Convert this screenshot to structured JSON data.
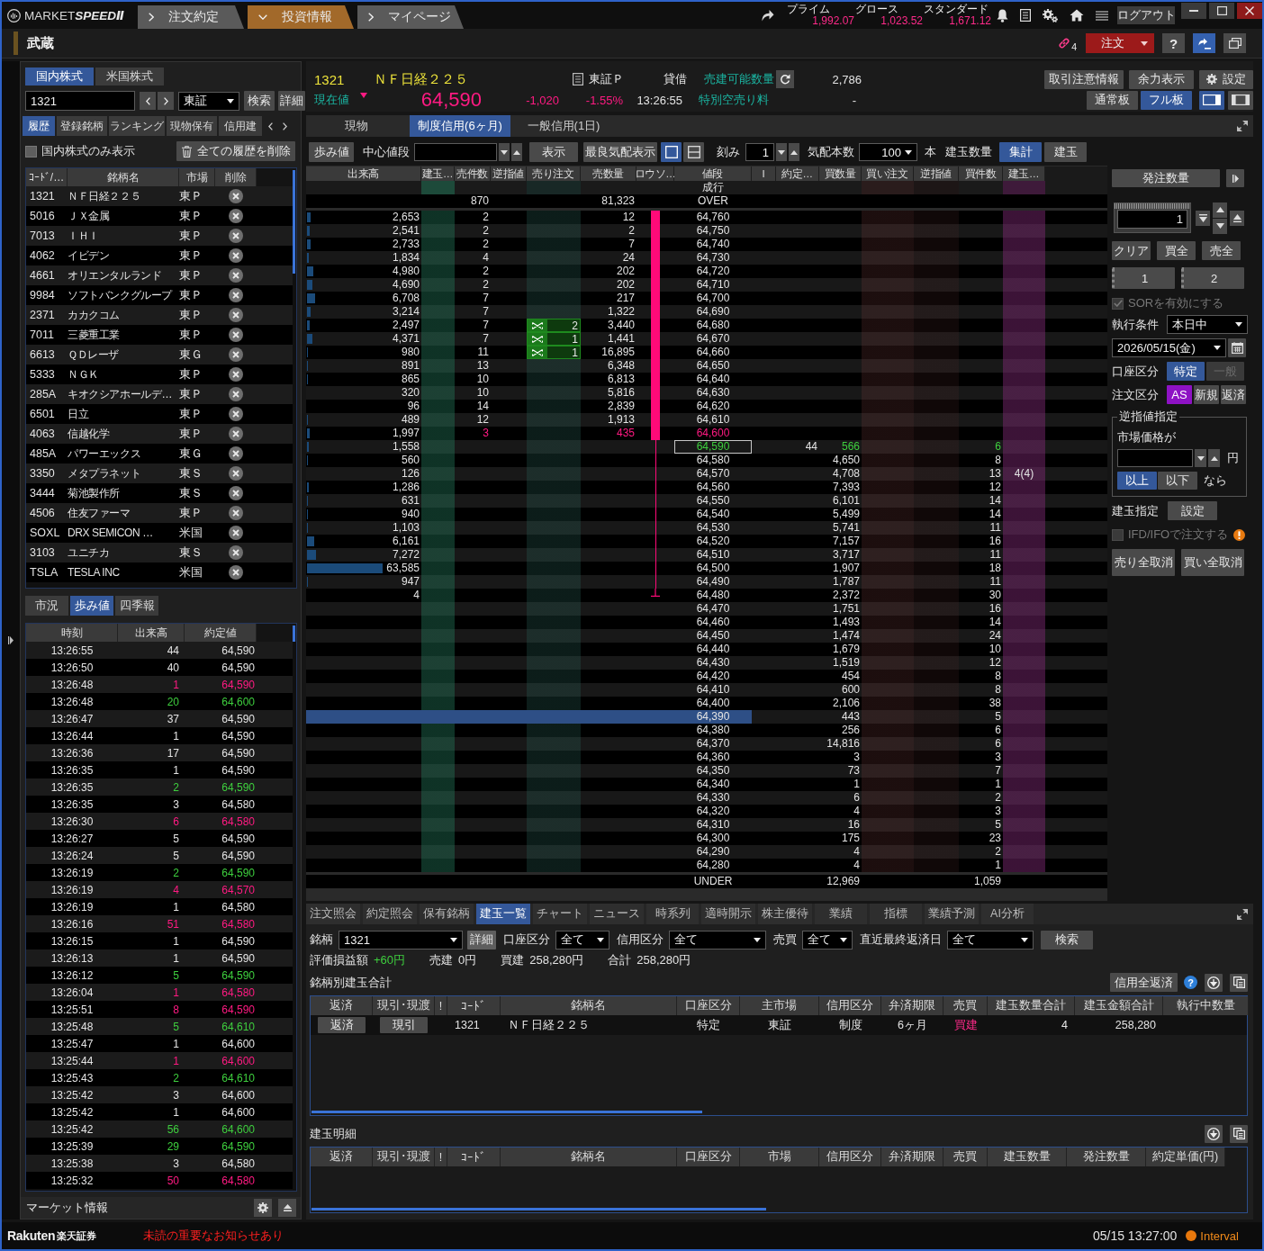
{
  "title_bar": {
    "logo": "MARKET**SPEEDⅡ**",
    "nav_tabs": [
      {
        "label": "注文約定",
        "selected": false
      },
      {
        "label": "投資情報",
        "selected": true
      },
      {
        "label": "マイページ",
        "selected": false
      }
    ],
    "indices": [
      {
        "name": "プライム",
        "value": "1,992.07"
      },
      {
        "name": "グロース",
        "value": "1,023.52"
      },
      {
        "name": "スタンダード",
        "value": "1,671.12"
      }
    ],
    "logout": "ログアウト"
  },
  "window": {
    "title": "武蔵",
    "link_count": "4",
    "order_button": "注文",
    "help_button": "?"
  },
  "left_panel": {
    "market_tabs": [
      {
        "label": "国内株式",
        "selected": true
      },
      {
        "label": "米国株式",
        "selected": false
      }
    ],
    "code_input": {
      "value": "1321"
    },
    "exchange": "東証",
    "search_button": "検索",
    "detail_button": "詳細",
    "list_tabs": [
      {
        "label": "履歴",
        "selected": true
      },
      {
        "label": "登録銘柄",
        "selected": false
      },
      {
        "label": "ランキング",
        "selected": false
      },
      {
        "label": "現物保有",
        "selected": false
      },
      {
        "label": "信用建",
        "selected": false
      }
    ],
    "domestic_only": {
      "label": "国内株式のみ表示",
      "checked": false
    },
    "clear_history_button": "全ての履歴を削除",
    "history": {
      "columns": [
        "ｺｰﾄﾞ/…",
        "銘柄名",
        "市場",
        "削除"
      ],
      "rows": [
        {
          "code": "1321",
          "name": "ＮＦ日経２２５",
          "market": "東Ｐ"
        },
        {
          "code": "5016",
          "name": "ＪＸ金属",
          "market": "東Ｐ"
        },
        {
          "code": "7013",
          "name": "ＩＨＩ",
          "market": "東Ｐ"
        },
        {
          "code": "4062",
          "name": "イビデン",
          "market": "東Ｐ"
        },
        {
          "code": "4661",
          "name": "オリエンタルランド",
          "market": "東Ｐ"
        },
        {
          "code": "9984",
          "name": "ソフトバンクグループ",
          "market": "東Ｐ"
        },
        {
          "code": "2371",
          "name": "カカクコム",
          "market": "東Ｐ"
        },
        {
          "code": "7011",
          "name": "三菱重工業",
          "market": "東Ｐ"
        },
        {
          "code": "6613",
          "name": "ＱＤレーザ",
          "market": "東Ｇ"
        },
        {
          "code": "5333",
          "name": "ＮＧＫ",
          "market": "東Ｐ"
        },
        {
          "code": "285A",
          "name": "キオクシアホールデ…",
          "market": "東Ｐ"
        },
        {
          "code": "6501",
          "name": "日立",
          "market": "東Ｐ"
        },
        {
          "code": "4063",
          "name": "信越化学",
          "market": "東Ｐ"
        },
        {
          "code": "485A",
          "name": "パワーエックス",
          "market": "東Ｇ"
        },
        {
          "code": "3350",
          "name": "メタプラネット",
          "market": "東Ｓ"
        },
        {
          "code": "3444",
          "name": "菊池製作所",
          "market": "東Ｓ"
        },
        {
          "code": "4506",
          "name": "住友ファーマ",
          "market": "東Ｐ"
        },
        {
          "code": "SOXL",
          "name": "DRX SEMICON …",
          "market": "米国"
        },
        {
          "code": "3103",
          "name": "ユニチカ",
          "market": "東Ｓ"
        },
        {
          "code": "TSLA",
          "name": "TESLA INC",
          "market": "米国"
        }
      ]
    },
    "info_tabs": [
      {
        "label": "市況",
        "selected": false
      },
      {
        "label": "歩み値",
        "selected": true
      },
      {
        "label": "四季報",
        "selected": false
      }
    ],
    "trades": {
      "columns": [
        "時刻",
        "出来高",
        "約定値"
      ],
      "rows": [
        {
          "time": "13:26:55",
          "volume": "44",
          "price": "64,590",
          "kind": "flat"
        },
        {
          "time": "13:26:50",
          "volume": "40",
          "price": "64,590",
          "kind": "flat"
        },
        {
          "time": "13:26:48",
          "volume": "1",
          "price": "64,590",
          "kind": "down"
        },
        {
          "time": "13:26:48",
          "volume": "20",
          "price": "64,600",
          "kind": "up"
        },
        {
          "time": "13:26:47",
          "volume": "37",
          "price": "64,590",
          "kind": "flat"
        },
        {
          "time": "13:26:44",
          "volume": "1",
          "price": "64,590",
          "kind": "flat"
        },
        {
          "time": "13:26:36",
          "volume": "17",
          "price": "64,590",
          "kind": "flat"
        },
        {
          "time": "13:26:35",
          "volume": "1",
          "price": "64,590",
          "kind": "flat"
        },
        {
          "time": "13:26:35",
          "volume": "2",
          "price": "64,590",
          "kind": "up"
        },
        {
          "time": "13:26:35",
          "volume": "3",
          "price": "64,580",
          "kind": "flat"
        },
        {
          "time": "13:26:30",
          "volume": "6",
          "price": "64,580",
          "kind": "down"
        },
        {
          "time": "13:26:27",
          "volume": "5",
          "price": "64,590",
          "kind": "flat"
        },
        {
          "time": "13:26:24",
          "volume": "5",
          "price": "64,590",
          "kind": "flat"
        },
        {
          "time": "13:26:19",
          "volume": "2",
          "price": "64,590",
          "kind": "up"
        },
        {
          "time": "13:26:19",
          "volume": "4",
          "price": "64,570",
          "kind": "down"
        },
        {
          "time": "13:26:19",
          "volume": "1",
          "price": "64,580",
          "kind": "flat"
        },
        {
          "time": "13:26:16",
          "volume": "51",
          "price": "64,580",
          "kind": "down"
        },
        {
          "time": "13:26:15",
          "volume": "1",
          "price": "64,590",
          "kind": "flat"
        },
        {
          "time": "13:26:13",
          "volume": "1",
          "price": "64,590",
          "kind": "flat"
        },
        {
          "time": "13:26:12",
          "volume": "5",
          "price": "64,590",
          "kind": "up"
        },
        {
          "time": "13:26:04",
          "volume": "1",
          "price": "64,580",
          "kind": "down"
        },
        {
          "time": "13:25:51",
          "volume": "8",
          "price": "64,590",
          "kind": "down"
        },
        {
          "time": "13:25:48",
          "volume": "5",
          "price": "64,610",
          "kind": "up"
        },
        {
          "time": "13:25:47",
          "volume": "1",
          "price": "64,600",
          "kind": "flat"
        },
        {
          "time": "13:25:44",
          "volume": "1",
          "price": "64,600",
          "kind": "down"
        },
        {
          "time": "13:25:43",
          "volume": "2",
          "price": "64,610",
          "kind": "up"
        },
        {
          "time": "13:25:42",
          "volume": "3",
          "price": "64,600",
          "kind": "flat"
        },
        {
          "time": "13:25:42",
          "volume": "1",
          "price": "64,600",
          "kind": "flat"
        },
        {
          "time": "13:25:42",
          "volume": "56",
          "price": "64,600",
          "kind": "up"
        },
        {
          "time": "13:25:39",
          "volume": "29",
          "price": "64,590",
          "kind": "up"
        },
        {
          "time": "13:25:38",
          "volume": "3",
          "price": "64,580",
          "kind": "flat"
        },
        {
          "time": "13:25:32",
          "volume": "50",
          "price": "64,580",
          "kind": "down"
        }
      ]
    },
    "footer": "マーケット情報"
  },
  "quote": {
    "code": "1321",
    "name": "ＮＦ日経２２５",
    "exchange": "東証Ｐ",
    "margin_type": "貸借",
    "sellable_label": "売建可能数量",
    "sellable": "2,786",
    "price_label": "現在値",
    "price_down": true,
    "price": "64,590",
    "change": "-1,020",
    "change_pct": "-1.55%",
    "time": "13:26:55",
    "fee_label": "特別空売り料",
    "fee": "-",
    "buttons": [
      "取引注意情報",
      "余力表示",
      "設定"
    ],
    "board_modes": [
      {
        "label": "通常板",
        "selected": false
      },
      {
        "label": "フル板",
        "selected": true
      }
    ],
    "layouts": [
      {
        "kind": "single",
        "selected": true
      },
      {
        "kind": "triple",
        "selected": false
      }
    ]
  },
  "board_tabs": [
    {
      "label": "現物",
      "selected": false
    },
    {
      "label": "制度信用(6ヶ月)",
      "selected": true
    },
    {
      "label": "一般信用(1日)",
      "selected": false
    }
  ],
  "toolbar": {
    "trades_button": "歩み値",
    "center_label": "中心値段",
    "show_button": "表示",
    "best_button": "最良気配表示",
    "views": [
      {
        "kind": "single",
        "selected": true
      },
      {
        "kind": "split",
        "selected": false
      }
    ],
    "tick_label": "刻み",
    "tick_value": "1",
    "depth_label": "気配本数",
    "depth_value": "100",
    "depth_unit": "本",
    "position_label": "建玉数量",
    "position_modes": [
      {
        "label": "集計",
        "selected": true
      },
      {
        "label": "建玉",
        "selected": false
      }
    ]
  },
  "board": {
    "columns": [
      "出来高",
      "建玉…",
      "売件数",
      "逆指値",
      "売り注文",
      "売数量",
      "ロウソ…",
      "値段",
      "I",
      "約定…",
      "買数量",
      "買い注文",
      "逆指値",
      "買件数",
      "建玉…"
    ],
    "market_row": {
      "price": "成行"
    },
    "over_row": {
      "sell_count": "870",
      "sell_qty": "81,323",
      "price": "OVER"
    },
    "rows": [
      {
        "volume": "2,653",
        "sell_count": "2",
        "sell_qty": "12",
        "price": "64,760",
        "kind": "plain",
        "current": false,
        "candle_body": true,
        "candle_wick": false,
        "selected": false
      },
      {
        "volume": "2,541",
        "sell_count": "2",
        "sell_qty": "2",
        "price": "64,750",
        "kind": "plain",
        "current": false,
        "candle_body": true,
        "candle_wick": false,
        "selected": false
      },
      {
        "volume": "2,733",
        "sell_count": "2",
        "sell_qty": "7",
        "price": "64,740",
        "kind": "plain",
        "current": false,
        "candle_body": true,
        "candle_wick": false,
        "selected": false
      },
      {
        "volume": "1,834",
        "sell_count": "4",
        "sell_qty": "24",
        "price": "64,730",
        "kind": "plain",
        "current": false,
        "candle_body": true,
        "candle_wick": false,
        "selected": false
      },
      {
        "volume": "4,980",
        "sell_count": "2",
        "sell_qty": "202",
        "price": "64,720",
        "kind": "plain",
        "current": false,
        "candle_body": true,
        "candle_wick": false,
        "selected": false
      },
      {
        "volume": "4,690",
        "sell_count": "2",
        "sell_qty": "202",
        "price": "64,710",
        "kind": "plain",
        "current": false,
        "candle_body": true,
        "candle_wick": false,
        "selected": false
      },
      {
        "volume": "6,708",
        "sell_count": "7",
        "sell_qty": "217",
        "price": "64,700",
        "kind": "plain",
        "current": false,
        "candle_body": true,
        "candle_wick": false,
        "selected": false
      },
      {
        "volume": "3,214",
        "sell_count": "7",
        "sell_qty": "1,322",
        "price": "64,690",
        "kind": "plain",
        "current": false,
        "candle_body": true,
        "candle_wick": false,
        "selected": false
      },
      {
        "volume": "2,497",
        "sell_count": "7",
        "sell_order": "2",
        "sell_qty": "3,440",
        "price": "64,680",
        "kind": "plain",
        "current": false,
        "candle_body": true,
        "candle_wick": false,
        "selected": false
      },
      {
        "volume": "4,371",
        "sell_count": "7",
        "sell_order": "1",
        "sell_qty": "1,441",
        "price": "64,670",
        "kind": "plain",
        "current": false,
        "candle_body": true,
        "candle_wick": false,
        "selected": false
      },
      {
        "volume": "980",
        "sell_count": "11",
        "sell_order": "1",
        "sell_qty": "16,895",
        "price": "64,660",
        "kind": "plain",
        "current": false,
        "candle_body": true,
        "candle_wick": false,
        "selected": false
      },
      {
        "volume": "891",
        "sell_count": "13",
        "sell_qty": "6,348",
        "price": "64,650",
        "kind": "plain",
        "current": false,
        "candle_body": true,
        "candle_wick": false,
        "selected": false
      },
      {
        "volume": "865",
        "sell_count": "10",
        "sell_qty": "6,813",
        "price": "64,640",
        "kind": "plain",
        "current": false,
        "candle_body": true,
        "candle_wick": false,
        "selected": false
      },
      {
        "volume": "320",
        "sell_count": "10",
        "sell_qty": "5,816",
        "price": "64,630",
        "kind": "plain",
        "current": false,
        "candle_body": true,
        "candle_wick": false,
        "selected": false
      },
      {
        "volume": "96",
        "sell_count": "14",
        "sell_qty": "2,839",
        "price": "64,620",
        "kind": "plain",
        "current": false,
        "candle_body": true,
        "candle_wick": false,
        "selected": false
      },
      {
        "volume": "489",
        "sell_count": "12",
        "sell_qty": "1,913",
        "price": "64,610",
        "kind": "plain",
        "current": false,
        "candle_body": true,
        "candle_wick": false,
        "selected": false
      },
      {
        "volume": "1,997",
        "sell_count": "3",
        "sell_qty": "435",
        "price": "64,600",
        "kind": "best_ask",
        "current": false,
        "candle_body": true,
        "candle_wick": false,
        "selected": false
      },
      {
        "volume": "1,558",
        "price": "64,590",
        "trade": "44",
        "buy_qty": "566",
        "buy_count": "6",
        "kind": "best_bid",
        "current": true,
        "candle_body": false,
        "candle_wick": true,
        "selected": false
      },
      {
        "volume": "560",
        "price": "64,580",
        "buy_qty": "4,650",
        "buy_count": "8",
        "kind": "plain",
        "current": false,
        "candle_body": false,
        "candle_wick": true,
        "selected": false
      },
      {
        "volume": "126",
        "price": "64,570",
        "buy_qty": "4,708",
        "buy_count": "13",
        "buy_position": "4(4)",
        "kind": "plain",
        "current": false,
        "candle_body": false,
        "candle_wick": true,
        "selected": false
      },
      {
        "volume": "1,286",
        "price": "64,560",
        "buy_qty": "7,393",
        "buy_count": "12",
        "kind": "plain",
        "current": false,
        "candle_body": false,
        "candle_wick": true,
        "selected": false
      },
      {
        "volume": "631",
        "price": "64,550",
        "buy_qty": "6,101",
        "buy_count": "14",
        "kind": "plain",
        "current": false,
        "candle_body": false,
        "candle_wick": true,
        "selected": false
      },
      {
        "volume": "940",
        "price": "64,540",
        "buy_qty": "5,499",
        "buy_count": "14",
        "kind": "plain",
        "current": false,
        "candle_body": false,
        "candle_wick": true,
        "selected": false
      },
      {
        "volume": "1,103",
        "price": "64,530",
        "buy_qty": "5,741",
        "buy_count": "11",
        "kind": "plain",
        "current": false,
        "candle_body": false,
        "candle_wick": true,
        "selected": false
      },
      {
        "volume": "6,161",
        "price": "64,520",
        "buy_qty": "7,157",
        "buy_count": "16",
        "kind": "plain",
        "current": false,
        "candle_body": false,
        "candle_wick": true,
        "selected": false
      },
      {
        "volume": "7,272",
        "price": "64,510",
        "buy_qty": "3,717",
        "buy_count": "11",
        "kind": "plain",
        "current": false,
        "candle_body": false,
        "candle_wick": true,
        "selected": false
      },
      {
        "volume": "63,585",
        "price": "64,500",
        "buy_qty": "1,907",
        "buy_count": "18",
        "kind": "plain",
        "current": false,
        "candle_body": false,
        "candle_wick": true,
        "selected": false
      },
      {
        "volume": "947",
        "price": "64,490",
        "buy_qty": "1,787",
        "buy_count": "11",
        "kind": "plain",
        "current": false,
        "candle_body": false,
        "candle_wick": true,
        "selected": false
      },
      {
        "volume": "4",
        "price": "64,480",
        "buy_qty": "2,372",
        "buy_count": "30",
        "kind": "plain",
        "current": false,
        "candle_body": false,
        "candle_wick": true,
        "selected": false
      },
      {
        "price": "64,470",
        "buy_qty": "1,751",
        "buy_count": "16",
        "kind": "plain",
        "current": false,
        "candle_body": false,
        "candle_wick": false,
        "selected": false
      },
      {
        "price": "64,460",
        "buy_qty": "1,493",
        "buy_count": "14",
        "kind": "plain",
        "current": false,
        "candle_body": false,
        "candle_wick": false,
        "selected": false
      },
      {
        "price": "64,450",
        "buy_qty": "1,474",
        "buy_count": "24",
        "kind": "plain",
        "current": false,
        "candle_body": false,
        "candle_wick": false,
        "selected": false
      },
      {
        "price": "64,440",
        "buy_qty": "1,679",
        "buy_count": "10",
        "kind": "plain",
        "current": false,
        "candle_body": false,
        "candle_wick": false,
        "selected": false
      },
      {
        "price": "64,430",
        "buy_qty": "1,519",
        "buy_count": "12",
        "kind": "plain",
        "current": false,
        "candle_body": false,
        "candle_wick": false,
        "selected": false
      },
      {
        "price": "64,420",
        "buy_qty": "454",
        "buy_count": "8",
        "kind": "plain",
        "current": false,
        "candle_body": false,
        "candle_wick": false,
        "selected": false
      },
      {
        "price": "64,410",
        "buy_qty": "600",
        "buy_count": "8",
        "kind": "plain",
        "current": false,
        "candle_body": false,
        "candle_wick": false,
        "selected": false
      },
      {
        "price": "64,400",
        "buy_qty": "2,106",
        "buy_count": "38",
        "kind": "plain",
        "current": false,
        "candle_body": false,
        "candle_wick": false,
        "selected": false
      },
      {
        "price": "64,390",
        "buy_qty": "443",
        "buy_count": "5",
        "kind": "plain",
        "current": false,
        "candle_body": false,
        "candle_wick": false,
        "selected": true
      },
      {
        "price": "64,380",
        "buy_qty": "256",
        "buy_count": "6",
        "kind": "plain",
        "current": false,
        "candle_body": false,
        "candle_wick": false,
        "selected": false
      },
      {
        "price": "64,370",
        "buy_qty": "14,816",
        "buy_count": "6",
        "kind": "plain",
        "current": false,
        "candle_body": false,
        "candle_wick": false,
        "selected": false
      },
      {
        "price": "64,360",
        "buy_qty": "3",
        "buy_count": "3",
        "kind": "plain",
        "current": false,
        "candle_body": false,
        "candle_wick": false,
        "selected": false
      },
      {
        "price": "64,350",
        "buy_qty": "73",
        "buy_count": "7",
        "kind": "plain",
        "current": false,
        "candle_body": false,
        "candle_wick": false,
        "selected": false
      },
      {
        "price": "64,340",
        "buy_qty": "1",
        "buy_count": "1",
        "kind": "plain",
        "current": false,
        "candle_body": false,
        "candle_wick": false,
        "selected": false
      },
      {
        "price": "64,330",
        "buy_qty": "6",
        "buy_count": "2",
        "kind": "plain",
        "current": false,
        "candle_body": false,
        "candle_wick": false,
        "selected": false
      },
      {
        "price": "64,320",
        "buy_qty": "4",
        "buy_count": "3",
        "kind": "plain",
        "current": false,
        "candle_body": false,
        "candle_wick": false,
        "selected": false
      },
      {
        "price": "64,310",
        "buy_qty": "16",
        "buy_count": "5",
        "kind": "plain",
        "current": false,
        "candle_body": false,
        "candle_wick": false,
        "selected": false
      },
      {
        "price": "64,300",
        "buy_qty": "175",
        "buy_count": "23",
        "kind": "plain",
        "current": false,
        "candle_body": false,
        "candle_wick": false,
        "selected": false
      },
      {
        "price": "64,290",
        "buy_qty": "4",
        "buy_count": "2",
        "kind": "plain",
        "current": false,
        "candle_body": false,
        "candle_wick": false,
        "selected": false
      },
      {
        "price": "64,280",
        "buy_qty": "4",
        "buy_count": "1",
        "kind": "plain",
        "current": false,
        "candle_body": false,
        "candle_wick": false,
        "selected": false
      }
    ],
    "under_row": {
      "price": "UNDER",
      "buy_qty": "12,969",
      "buy_count": "1,059"
    }
  },
  "order_panel": {
    "title": "発注数量",
    "quantity": "1",
    "quick_buttons": [
      "クリア",
      "買全",
      "売全"
    ],
    "presets": [
      "1",
      "2"
    ],
    "sor": {
      "label": "SORを有効にする",
      "checked": true,
      "disabled": true
    },
    "condition_label": "執行条件",
    "condition": "本日中",
    "date": "2026/05/15(金)",
    "account_label": "口座区分",
    "accounts": [
      {
        "label": "特定",
        "selected": true,
        "disabled": false
      },
      {
        "label": "一般",
        "selected": false,
        "disabled": true
      }
    ],
    "order_type_label": "注文区分",
    "order_types": [
      {
        "label": "AS",
        "selected": true
      },
      {
        "label": "新規",
        "selected": false
      },
      {
        "label": "返済",
        "selected": false
      }
    ],
    "stop": {
      "title": "逆指値指定",
      "label": "市場価格が",
      "unit": "円",
      "conditions": [
        {
          "label": "以上",
          "selected": true
        },
        {
          "label": "以下",
          "selected": false
        }
      ],
      "suffix": "なら"
    },
    "position_label": "建玉指定",
    "position_button": "設定",
    "ifd": {
      "label": "IFD/IFOで注文する",
      "checked": false,
      "disabled": true
    },
    "cancel_buttons": [
      "売り全取消",
      "買い全取消"
    ]
  },
  "bottom": {
    "tabs": [
      {
        "label": "注文照会",
        "selected": false
      },
      {
        "label": "約定照会",
        "selected": false
      },
      {
        "label": "保有銘柄",
        "selected": false
      },
      {
        "label": "建玉一覧",
        "selected": true
      },
      {
        "label": "チャート",
        "selected": false
      },
      {
        "label": "ニュース",
        "selected": false
      },
      {
        "label": "時系列",
        "selected": false
      },
      {
        "label": "適時開示",
        "selected": false
      },
      {
        "label": "株主優待",
        "selected": false
      },
      {
        "label": "業績",
        "selected": false
      },
      {
        "label": "指標",
        "selected": false
      },
      {
        "label": "業績予測",
        "selected": false
      },
      {
        "label": "AI分析",
        "selected": false
      }
    ],
    "symbol_label": "銘柄",
    "symbol": "1321",
    "detail_button": "詳細",
    "filters": [
      {
        "label": "口座区分",
        "value": "全て"
      },
      {
        "label": "信用区分",
        "value": "全て"
      },
      {
        "label": "売買",
        "value": "全て"
      },
      {
        "label": "直近最終返済日",
        "value": "全て"
      }
    ],
    "search_button": "検索",
    "summary": [
      {
        "label": "評価損益額",
        "value": "+60円",
        "kind": "gain"
      },
      {
        "label": "売建",
        "value": "0円",
        "kind": "plain"
      },
      {
        "label": "買建",
        "value": "258,280円",
        "kind": "plain"
      },
      {
        "label": "合計",
        "value": "258,280円",
        "kind": "plain"
      }
    ],
    "totals": {
      "title": "銘柄別建玉合計",
      "settle_all_button": "信用全返済",
      "help": "?",
      "columns": [
        "返済",
        "現引･現渡",
        "!",
        "ｺｰﾄﾞ",
        "銘柄名",
        "口座区分",
        "主市場",
        "信用区分",
        "弁済期限",
        "売買",
        "建玉数量合計",
        "建玉金額合計",
        "執行中数量"
      ],
      "rows": [
        {
          "settle": "返済",
          "delivery": "現引",
          "code": "1321",
          "name": "ＮＦ日経２２５",
          "account": "特定",
          "market": "東証",
          "credit": "制度",
          "deadline": "6ヶ月",
          "side": "買建",
          "kind": "buy",
          "quantity": "4",
          "amount": "258,280"
        }
      ]
    },
    "details": {
      "title": "建玉明細",
      "columns": [
        "返済",
        "現引･現渡",
        "!",
        "ｺｰﾄﾞ",
        "銘柄名",
        "口座区分",
        "市場",
        "信用区分",
        "弁済期限",
        "売買",
        "建玉数量",
        "発注数量",
        "約定単価(円)"
      ]
    }
  },
  "status_bar": {
    "brand": "Rakuten",
    "brand_jp": "楽天証券",
    "notice": "未読の重要なお知らせあり",
    "time": "05/15 13:27:00",
    "mode": "Interval"
  }
}
